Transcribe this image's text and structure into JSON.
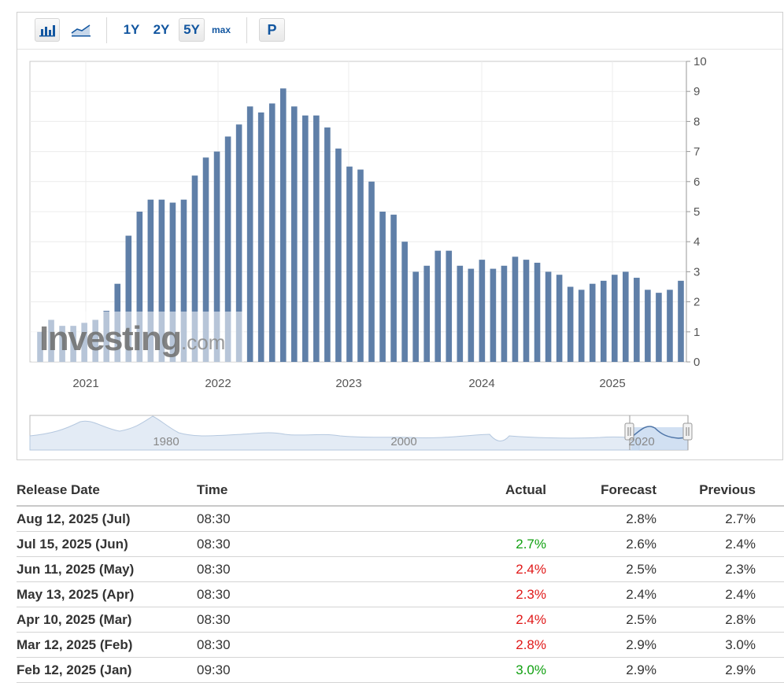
{
  "toolbar": {
    "icons": [
      "bar-chart-icon",
      "area-chart-icon"
    ],
    "ranges": [
      "1Y",
      "2Y",
      "5Y",
      "max"
    ],
    "selected_range": "5Y",
    "p_label": "P"
  },
  "watermark": {
    "text_main": "Investing",
    "text_suffix": ".com"
  },
  "chart_data": {
    "type": "bar",
    "color": "#5f7fa8",
    "ylim": [
      0,
      10
    ],
    "yticks": [
      0,
      1,
      2,
      3,
      4,
      5,
      6,
      7,
      8,
      9,
      10
    ],
    "year_labels": [
      "2021",
      "2022",
      "2023",
      "2024",
      "2025"
    ],
    "grid": true,
    "values": [
      1.0,
      1.4,
      1.2,
      1.2,
      1.3,
      1.4,
      1.7,
      2.6,
      4.2,
      5.0,
      5.4,
      5.4,
      5.3,
      5.4,
      6.2,
      6.8,
      7.0,
      7.5,
      7.9,
      8.5,
      8.3,
      8.6,
      9.1,
      8.5,
      8.2,
      8.2,
      7.8,
      7.1,
      6.5,
      6.4,
      6.0,
      5.0,
      4.9,
      4.0,
      3.0,
      3.2,
      3.7,
      3.7,
      3.2,
      3.1,
      3.4,
      3.1,
      3.2,
      3.5,
      3.4,
      3.3,
      3.0,
      2.9,
      2.5,
      2.4,
      2.6,
      2.7,
      2.9,
      3.0,
      2.8,
      2.4,
      2.3,
      2.4,
      2.7
    ],
    "navigator_labels": [
      "1980",
      "2000",
      "2020"
    ]
  },
  "table": {
    "headers": {
      "date": "Release Date",
      "time": "Time",
      "actual": "Actual",
      "forecast": "Forecast",
      "previous": "Previous"
    },
    "rows": [
      {
        "date": "Aug 12, 2025 (Jul)",
        "time": "08:30",
        "actual": "",
        "actual_color": "#333333",
        "forecast": "2.8%",
        "previous": "2.7%"
      },
      {
        "date": "Jul 15, 2025 (Jun)",
        "time": "08:30",
        "actual": "2.7%",
        "actual_color": "#10a010",
        "forecast": "2.6%",
        "previous": "2.4%"
      },
      {
        "date": "Jun 11, 2025 (May)",
        "time": "08:30",
        "actual": "2.4%",
        "actual_color": "#e01818",
        "forecast": "2.5%",
        "previous": "2.3%"
      },
      {
        "date": "May 13, 2025 (Apr)",
        "time": "08:30",
        "actual": "2.3%",
        "actual_color": "#e01818",
        "forecast": "2.4%",
        "previous": "2.4%"
      },
      {
        "date": "Apr 10, 2025 (Mar)",
        "time": "08:30",
        "actual": "2.4%",
        "actual_color": "#e01818",
        "forecast": "2.5%",
        "previous": "2.8%"
      },
      {
        "date": "Mar 12, 2025 (Feb)",
        "time": "08:30",
        "actual": "2.8%",
        "actual_color": "#e01818",
        "forecast": "2.9%",
        "previous": "3.0%"
      },
      {
        "date": "Feb 12, 2025 (Jan)",
        "time": "09:30",
        "actual": "3.0%",
        "actual_color": "#10a010",
        "forecast": "2.9%",
        "previous": "2.9%"
      }
    ]
  }
}
